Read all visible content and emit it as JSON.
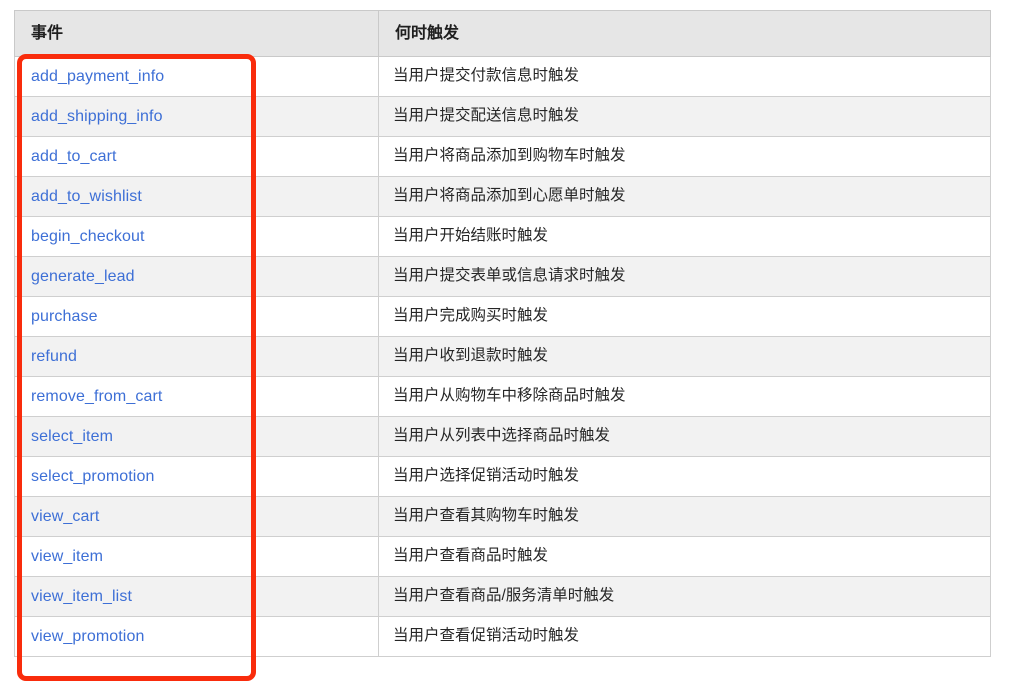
{
  "table": {
    "columns": [
      "事件",
      "何时触发"
    ],
    "rows": [
      {
        "event": "add_payment_info",
        "when": "当用户提交付款信息时触发"
      },
      {
        "event": "add_shipping_info",
        "when": "当用户提交配送信息时触发"
      },
      {
        "event": "add_to_cart",
        "when": "当用户将商品添加到购物车时触发"
      },
      {
        "event": "add_to_wishlist",
        "when": "当用户将商品添加到心愿单时触发"
      },
      {
        "event": "begin_checkout",
        "when": "当用户开始结账时触发"
      },
      {
        "event": "generate_lead",
        "when": "当用户提交表单或信息请求时触发"
      },
      {
        "event": "purchase",
        "when": "当用户完成购买时触发"
      },
      {
        "event": "refund",
        "when": "当用户收到退款时触发"
      },
      {
        "event": "remove_from_cart",
        "when": "当用户从购物车中移除商品时触发"
      },
      {
        "event": "select_item",
        "when": "当用户从列表中选择商品时触发"
      },
      {
        "event": "select_promotion",
        "when": "当用户选择促销活动时触发"
      },
      {
        "event": "view_cart",
        "when": "当用户查看其购物车时触发"
      },
      {
        "event": "view_item",
        "when": "当用户查看商品时触发"
      },
      {
        "event": "view_item_list",
        "when": "当用户查看商品/服务清单时触发"
      },
      {
        "event": "view_promotion",
        "when": "当用户查看促销活动时触发"
      }
    ]
  },
  "annotation": {
    "highlight_color": "#f92c0c"
  },
  "colors": {
    "link": "#3d6fd6",
    "header_background": "#e6e6e6",
    "row_alt_background": "#f2f2f2",
    "border": "#cfcfcf"
  }
}
